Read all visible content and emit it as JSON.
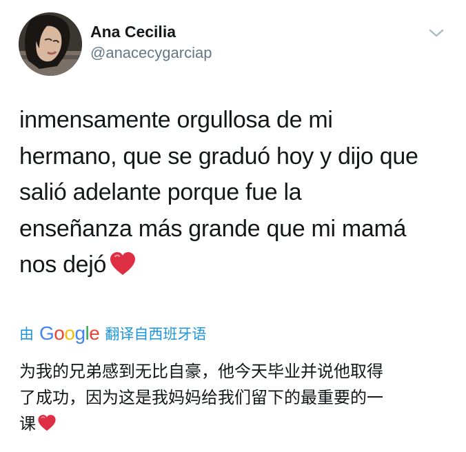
{
  "user": {
    "display_name": "Ana Cecilia",
    "handle": "@anacecygarciap",
    "avatar_icon": "profile-photo"
  },
  "menu": {
    "icon": "chevron-down-icon",
    "color": "#aab8c2"
  },
  "tweet": {
    "lines": [
      "inmensamente orgullosa de mi",
      "hermano, que se graduó hoy y dijo que",
      "salió adelante porque fue la",
      "enseñanza más grande que mi mamá",
      "nos dejó"
    ],
    "emoji": "red-heart"
  },
  "translation": {
    "by_label": "由",
    "provider": {
      "letters": [
        "G",
        "o",
        "o",
        "g",
        "l",
        "e"
      ],
      "colors": [
        "#4285f4",
        "#ea4335",
        "#fbbc05",
        "#4285f4",
        "#34a853",
        "#ea4335"
      ]
    },
    "source_label": "翻译自西班牙语",
    "link_color": "#1b95e0",
    "lines": [
      "为我的兄弟感到无比自豪，他今天毕业并说他取得",
      "了成功，因为这是我妈妈给我们留下的最重要的一",
      "课"
    ]
  }
}
